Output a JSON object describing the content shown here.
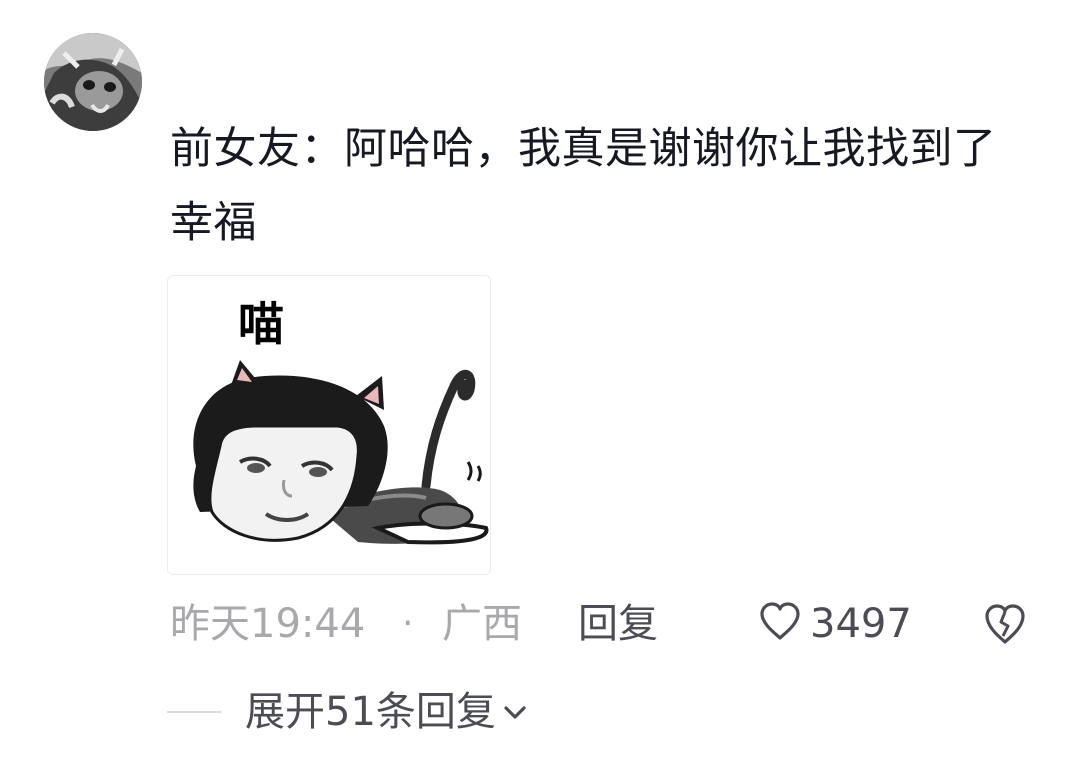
{
  "comment": {
    "text": "前女友：阿哈哈，我真是谢谢你让我找到了幸福",
    "sticker_caption": "喵",
    "time": "昨天19:44",
    "separator": "·",
    "location": "广西",
    "reply_label": "回复",
    "like_count": "3497",
    "expand_replies_label": "展开51条回复",
    "icons": {
      "like": "heart-outline-icon",
      "dislike": "broken-heart-icon",
      "expand": "chevron-down-icon"
    }
  }
}
